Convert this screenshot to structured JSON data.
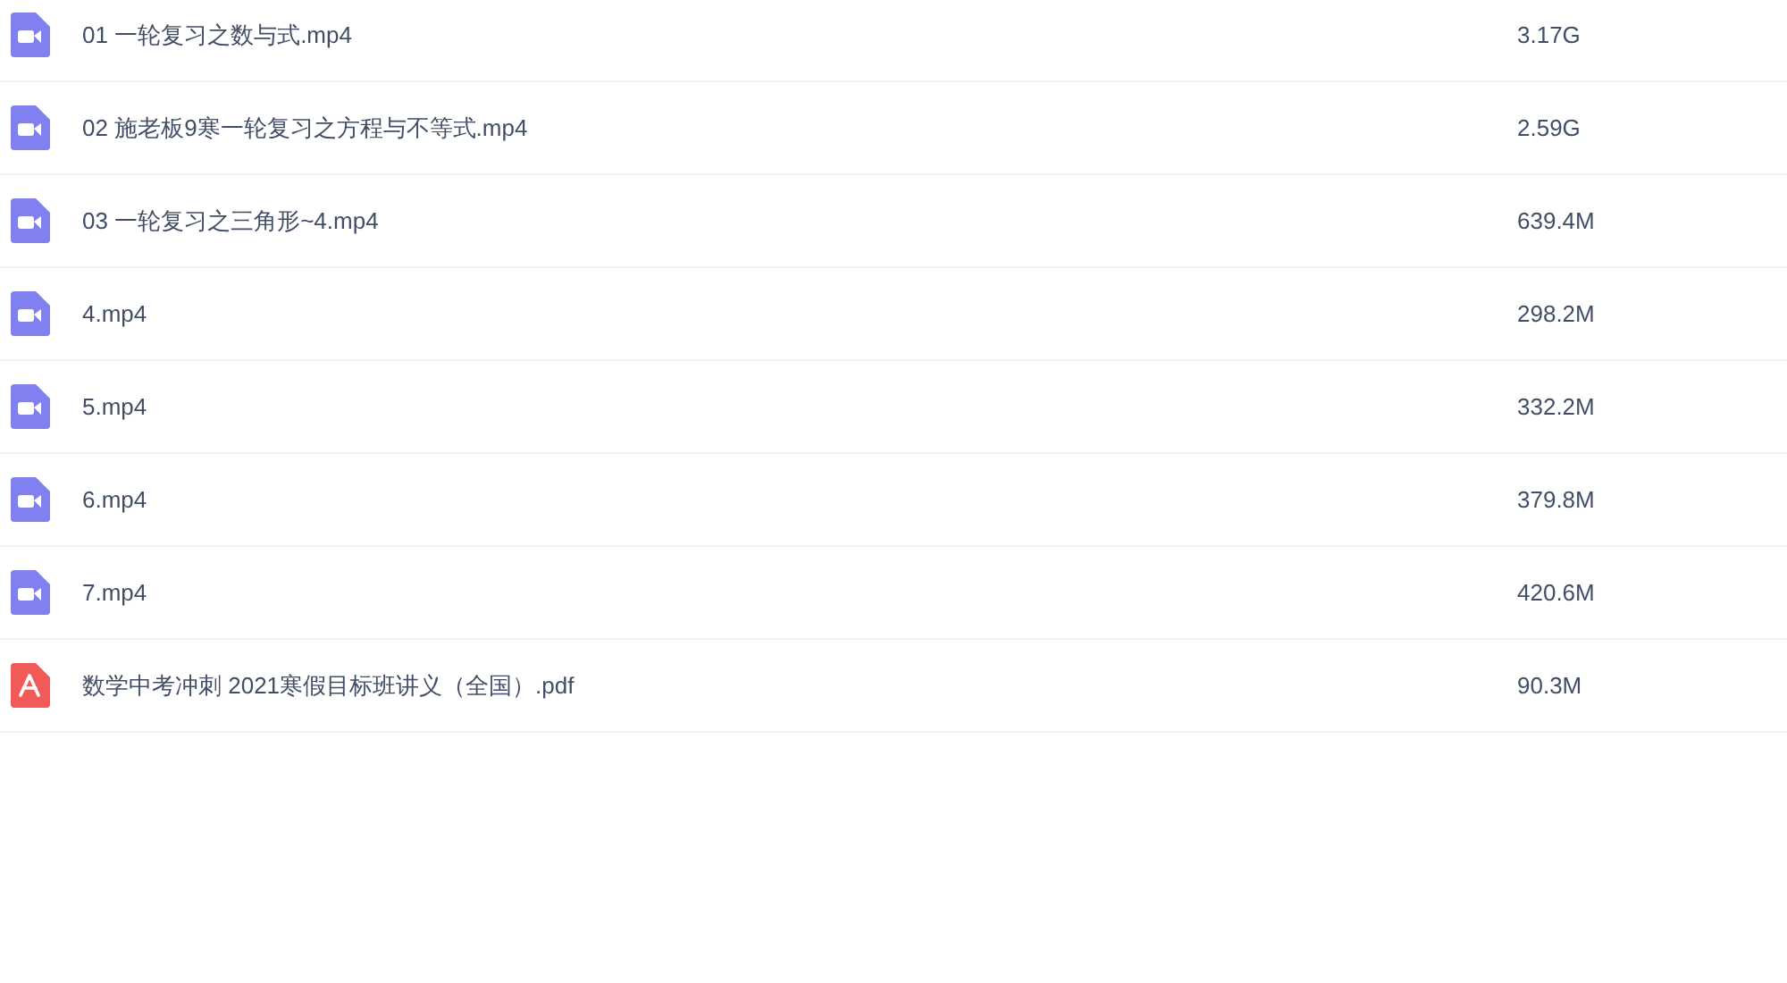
{
  "files": [
    {
      "kind": "video",
      "name": "01 一轮复习之数与式.mp4",
      "size": "3.17G"
    },
    {
      "kind": "video",
      "name": "02 施老板9寒一轮复习之方程与不等式.mp4",
      "size": "2.59G"
    },
    {
      "kind": "video",
      "name": "03 一轮复习之三角形~4.mp4",
      "size": "639.4M"
    },
    {
      "kind": "video",
      "name": "4.mp4",
      "size": "298.2M"
    },
    {
      "kind": "video",
      "name": "5.mp4",
      "size": "332.2M"
    },
    {
      "kind": "video",
      "name": "6.mp4",
      "size": "379.8M"
    },
    {
      "kind": "video",
      "name": "7.mp4",
      "size": "420.6M"
    },
    {
      "kind": "pdf",
      "name": "数学中考冲刺 2021寒假目标班讲义（全国）.pdf",
      "size": "90.3M"
    }
  ]
}
